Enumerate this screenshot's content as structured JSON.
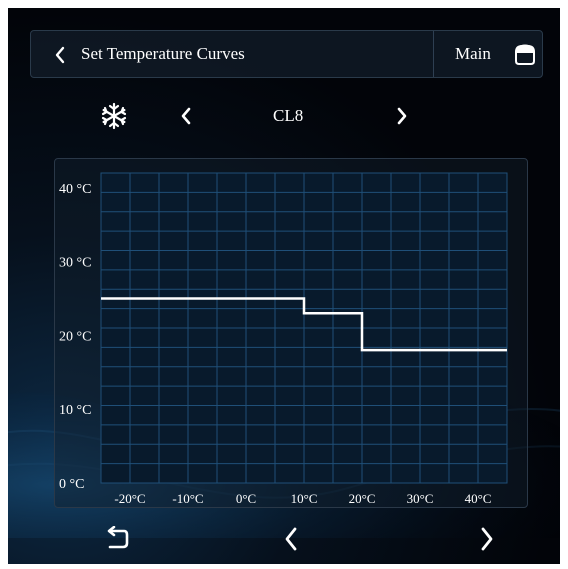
{
  "header": {
    "title": "Set Temperature Curves",
    "main_label": "Main",
    "back_icon": "chevron-left-icon",
    "home_icon": "home-icon"
  },
  "mode": {
    "icon": "snowflake-icon",
    "label": "CL8"
  },
  "colors": {
    "background": "#020409",
    "grid": "#1f4f78",
    "curve": "#ffffff",
    "text": "#ffffff"
  },
  "chart_data": {
    "type": "line",
    "title": "",
    "xlabel": "",
    "ylabel": "",
    "x_tick_labels": [
      "-20°C",
      "-10°C",
      "0°C",
      "10°C",
      "20°C",
      "30°C",
      "40°C"
    ],
    "y_tick_labels": [
      "0 °C",
      "10 °C",
      "20 °C",
      "30 °C",
      "40 °C"
    ],
    "x_ticks": [
      -20,
      -10,
      0,
      10,
      20,
      30,
      40
    ],
    "y_ticks": [
      0,
      10,
      20,
      30,
      40
    ],
    "xlim": [
      -25,
      45
    ],
    "ylim": [
      0,
      42
    ],
    "grid": true,
    "series": [
      {
        "x": [
          -25,
          10,
          10,
          20,
          20,
          45
        ],
        "y": [
          25,
          25,
          23,
          23,
          18,
          18
        ]
      }
    ]
  },
  "footer": {
    "undo_icon": "undo-icon",
    "prev_icon": "chevron-left-icon",
    "next_icon": "chevron-right-icon"
  }
}
